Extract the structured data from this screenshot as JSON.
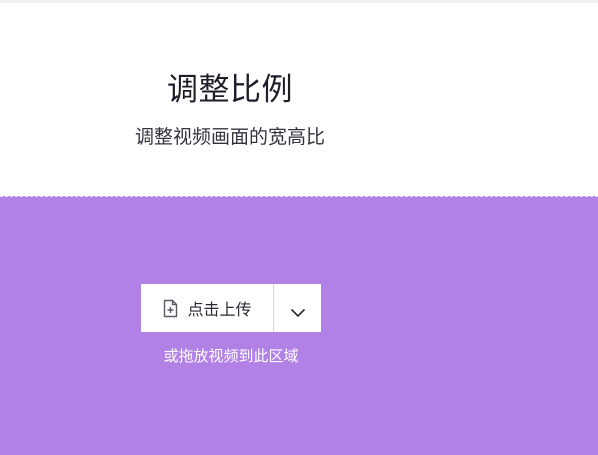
{
  "header": {
    "title": "调整比例",
    "subtitle": "调整视频画面的宽高比"
  },
  "upload": {
    "button_label": "点击上传",
    "upload_icon": "file-add-icon",
    "dropdown_icon": "chevron-down-icon",
    "hint": "或拖放视频到此区域"
  },
  "colors": {
    "dropzone_background": "#b281e6",
    "button_background": "#ffffff",
    "title_text": "#1e1e2a"
  }
}
